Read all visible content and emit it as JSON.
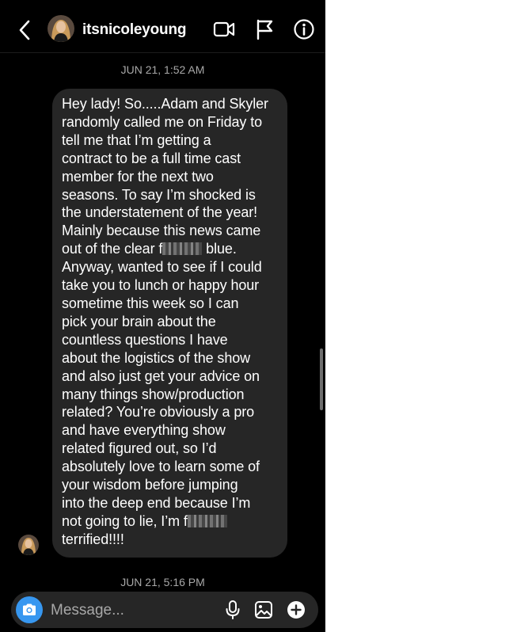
{
  "header": {
    "username": "itsnicoleyoung",
    "icons": [
      "back-icon",
      "video-call-icon",
      "flag-icon",
      "info-icon"
    ]
  },
  "thread": {
    "timestamp_top": "JUN 21, 1:52 AM",
    "timestamp_bottom": "JUN 21, 5:16 PM",
    "message": {
      "lines": [
        "Hey lady! So.....Adam and Skyler",
        "randomly called me on Friday to",
        "tell me that I’m getting a",
        "contract to be a full time cast",
        "member for the next two",
        "seasons. To say I’m shocked is",
        "the understatement of the year!",
        "Mainly because this news came",
        "out of the clear f",
        " blue.",
        "Anyway, wanted to see if I could",
        "take you to lunch or happy hour",
        "sometime this week so I can",
        "pick your brain about the",
        "countless questions I have",
        "about the logistics of the show",
        "and also just get your advice on",
        "many things show/production",
        "related? You’re obviously a pro",
        "and have everything show",
        "related figured out, so I’d",
        "absolutely love to learn some of",
        "your wisdom before jumping",
        "into the deep end because I’m",
        "not going to lie, I’m f",
        "terrified!!!!"
      ]
    }
  },
  "composer": {
    "placeholder": "Message...",
    "icons": [
      "camera-icon",
      "microphone-icon",
      "gallery-icon",
      "plus-icon"
    ]
  },
  "colors": {
    "background": "#000000",
    "bubble": "#262626",
    "accent": "#3797f0",
    "muted_text": "#a8a8a8"
  }
}
